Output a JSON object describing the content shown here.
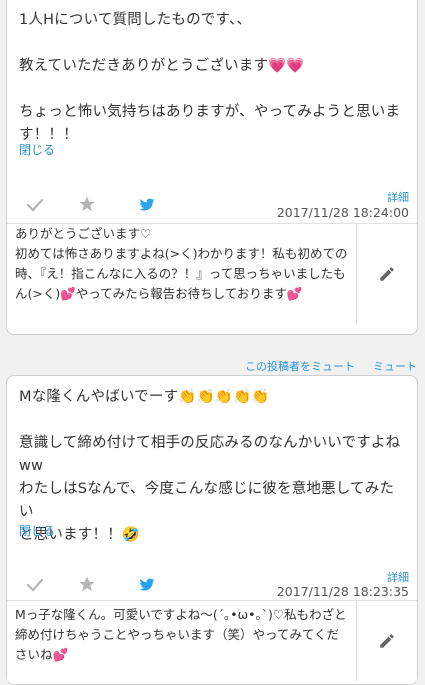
{
  "post1": {
    "text": "1人Hについて質問したものです、、\n\n教えていただきありがとうございます💗💗\n\nちょっと怖い気持ちはありますが、やってみようと思いま\nす！！！",
    "close_label": "閉じる",
    "detail_label": "詳細",
    "timestamp": "2017/11/28 18:24:00",
    "reply_text": "ありがとうございます♡\n初めては怖さありますよね(>く)わかります！私も初めての時、『え！指こんなに入るの？！』って思っちゃいましたもん(>く)💕やってみたら報告お待ちしております💕"
  },
  "mute": {
    "mute_poster_label": "この投稿者をミュート",
    "mute_label": "ミュート"
  },
  "post2": {
    "text": "Mな隆くんやばいでーす👏👏👏👏👏\n\n意識して締め付けて相手の反応みるのなんかいいですよね\nww\nわたしはSなんで、今度こんな感じに彼を意地悪してみたい\nと思います！！🤣",
    "close_label": "閉じる",
    "detail_label": "詳細",
    "timestamp": "2017/11/28 18:23:35",
    "reply_text": "Mっ子な隆くん。可愛いですよね〜(´｡•ω•｡`)♡私もわざと締め付けちゃうことやっちゃいます（笑）やってみてくださいね💕"
  },
  "icons": {
    "check": "check-icon",
    "star": "star-icon",
    "twitter": "twitter-bird-icon",
    "pencil": "pencil-icon"
  },
  "colors": {
    "link": "#2b93d6",
    "icon_gray": "#b5b5b5",
    "twitter_blue": "#2aa3ef",
    "pencil": "#666666"
  }
}
